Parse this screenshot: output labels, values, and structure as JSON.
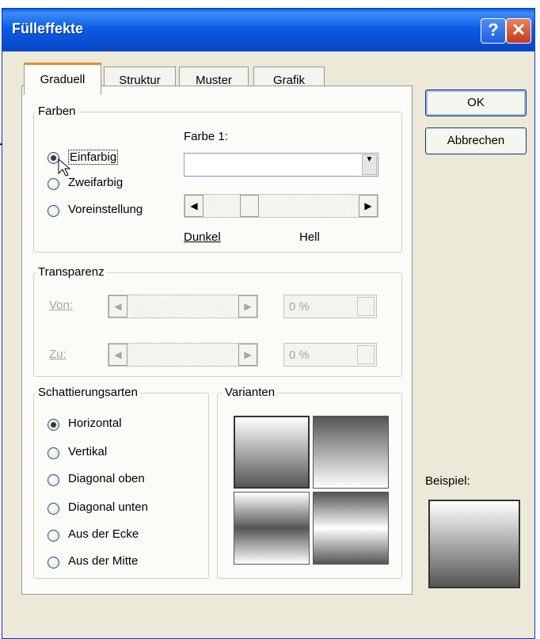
{
  "window": {
    "title": "Fülleffekte",
    "help_glyph": "?",
    "close_glyph": "✕"
  },
  "tabs": [
    {
      "label": "Graduell",
      "active": true
    },
    {
      "label": "Struktur",
      "active": false
    },
    {
      "label": "Muster",
      "active": false
    },
    {
      "label": "Grafik",
      "active": false
    }
  ],
  "farben": {
    "legend": "Farben",
    "options": [
      "Einfarbig",
      "Zweifarbig",
      "Voreinstellung"
    ],
    "selected": "Einfarbig",
    "farbe_label": "Farbe 1:",
    "slider_left_label": "Dunkel",
    "slider_right_label": "Hell"
  },
  "transparenz": {
    "legend": "Transparenz",
    "von_label": "Von:",
    "zu_label": "Zu:",
    "von_value": "0 %",
    "zu_value": "0 %"
  },
  "schattierung": {
    "legend": "Schattierungsarten",
    "options": [
      "Horizontal",
      "Vertikal",
      "Diagonal oben",
      "Diagonal unten",
      "Aus der Ecke",
      "Aus der Mitte"
    ],
    "selected": "Horizontal"
  },
  "varianten": {
    "legend": "Varianten"
  },
  "buttons": {
    "ok": "OK",
    "cancel": "Abbrechen"
  },
  "beispiel": {
    "label": "Beispiel:"
  },
  "colors": {
    "titlebar": "#0a5ee6",
    "dialog_bg": "#ece9d8",
    "tab_highlight": "#e68b2c"
  }
}
